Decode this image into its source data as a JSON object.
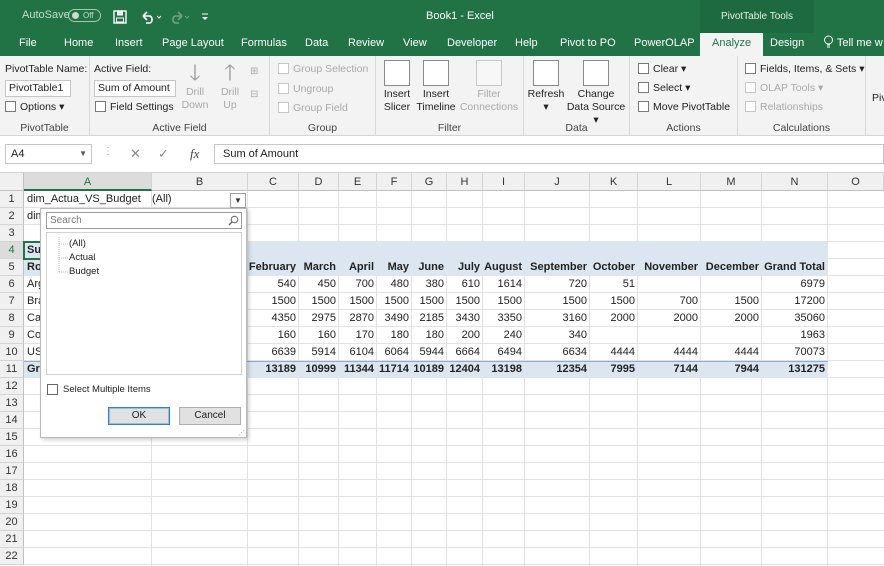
{
  "titlebar": {
    "autosave": "AutoSave",
    "autosave_state": "Off",
    "title": "Book1 - Excel",
    "context_tab": "PivotTable Tools"
  },
  "tabs": [
    "File",
    "Home",
    "Insert",
    "Page Layout",
    "Formulas",
    "Data",
    "Review",
    "View",
    "Developer",
    "Help",
    "Pivot to PO",
    "PowerOLAP",
    "Analyze",
    "Design",
    "Tell me w"
  ],
  "ribbon": {
    "pivottable": {
      "name_label": "PivotTable Name:",
      "name_value": "PivotTable1",
      "options": "Options",
      "group": "PivotTable"
    },
    "activefield": {
      "label": "Active Field:",
      "value": "Sum of Amount",
      "settings": "Field Settings",
      "drill_down": "Drill Down",
      "drill_up": "Drill Up",
      "group": "Active Field"
    },
    "group": {
      "selection": "Group Selection",
      "ungroup": "Ungroup",
      "field": "Group Field",
      "group": "Group"
    },
    "filter": {
      "slicer": "Insert Slicer",
      "timeline": "Insert Timeline",
      "connections": "Filter Connections",
      "group": "Filter"
    },
    "data": {
      "refresh": "Refresh",
      "change": "Change Data Source",
      "group": "Data"
    },
    "actions": {
      "clear": "Clear",
      "select": "Select",
      "move": "Move PivotTable",
      "group": "Actions"
    },
    "calculations": {
      "fields": "Fields, Items, & Sets",
      "olap": "OLAP Tools",
      "relationships": "Relationships",
      "group": "Calculations"
    },
    "overflow": "Pivo"
  },
  "formula_bar": {
    "namebox": "A4",
    "cancel": "✕",
    "enter": "✓",
    "fx": "fx",
    "content": "Sum of Amount"
  },
  "columns": [
    "A",
    "B",
    "C",
    "D",
    "E",
    "F",
    "G",
    "H",
    "I",
    "J",
    "K",
    "L",
    "M",
    "N",
    "O"
  ],
  "rows": [
    "1",
    "2",
    "3",
    "4",
    "5",
    "6",
    "7",
    "8",
    "9",
    "10",
    "11",
    "12",
    "13",
    "14",
    "15",
    "16",
    "17",
    "18",
    "19",
    "20",
    "21",
    "22"
  ],
  "sheet": {
    "a1": "dim_Actua_VS_Budget",
    "b1": "(All)",
    "a2": "dim",
    "a4": "Sur",
    "a5": "Row",
    "row_labels": [
      "Arg",
      "Bra",
      "Car",
      "Co",
      "USA",
      "Gra"
    ],
    "months": [
      "February",
      "March",
      "April",
      "May",
      "June",
      "July",
      "August",
      "September",
      "October",
      "November",
      "December",
      "Grand Total"
    ],
    "values": [
      [
        "540",
        "450",
        "700",
        "480",
        "380",
        "610",
        "1614",
        "720",
        "51",
        "",
        "",
        "6979"
      ],
      [
        "1500",
        "1500",
        "1500",
        "1500",
        "1500",
        "1500",
        "1500",
        "1500",
        "1500",
        "700",
        "1500",
        "17200"
      ],
      [
        "4350",
        "2975",
        "2870",
        "3490",
        "2185",
        "3430",
        "3350",
        "3160",
        "2000",
        "2000",
        "2000",
        "35060"
      ],
      [
        "160",
        "160",
        "170",
        "180",
        "180",
        "200",
        "240",
        "340",
        "",
        "",
        "",
        "1963"
      ],
      [
        "6639",
        "5914",
        "6104",
        "6064",
        "5944",
        "6664",
        "6494",
        "6634",
        "4444",
        "4444",
        "4444",
        "70073"
      ],
      [
        "13189",
        "10999",
        "11344",
        "11714",
        "10189",
        "12404",
        "13198",
        "12354",
        "7995",
        "7144",
        "7944",
        "131275"
      ]
    ]
  },
  "popup": {
    "search_placeholder": "Search",
    "items": [
      "(All)",
      "Actual",
      "Budget"
    ],
    "multi": "Select Multiple Items",
    "ok": "OK",
    "cancel": "Cancel"
  }
}
